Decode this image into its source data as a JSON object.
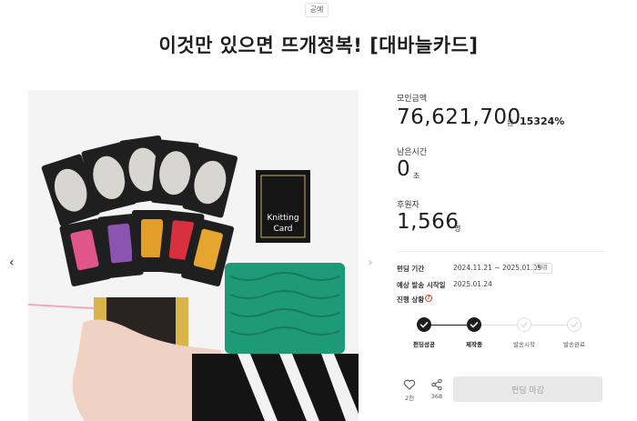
{
  "category": "공예",
  "title": "이것만 있으면 뜨개정복! [대바늘카드]",
  "nav": {
    "prev_icon": "chevron-left-icon",
    "next_icon": "chevron-right-icon",
    "prev": "‹",
    "next": "›"
  },
  "stats": {
    "amount_label": "모인금액",
    "amount_value": "76,621,700",
    "amount_unit": "원",
    "amount_percent": "15324%",
    "time_label": "남은시간",
    "time_value": "0",
    "time_unit": "초",
    "backers_label": "후원자",
    "backers_value": "1,566",
    "backers_unit": "명"
  },
  "info": {
    "period_label": "펀딩 기간",
    "period_value": "2024.11.21 ~ 2025.01.05",
    "period_badge": "마감",
    "ship_label": "예상 발송 시작일",
    "ship_value": "2025.01.24",
    "status_label": "진행 상황",
    "status_help": "?"
  },
  "steps": [
    {
      "label": "펀딩성공",
      "done": true
    },
    {
      "label": "제작중",
      "done": true
    },
    {
      "label": "발송시작",
      "done": false
    },
    {
      "label": "발송완료",
      "done": false
    }
  ],
  "actions": {
    "like_icon": "heart-icon",
    "like_count": "2천",
    "share_icon": "share-icon",
    "share_count": "368",
    "fund_button": "펀딩 마감"
  },
  "photo": {
    "card_box_text_1": "Knitting",
    "card_box_text_2": "Card"
  },
  "colors": {
    "accent_done": "#1d1d1d",
    "help_red": "#e0483c",
    "button_bg": "#e9e9e9",
    "knit_green": "#1f9a78"
  }
}
